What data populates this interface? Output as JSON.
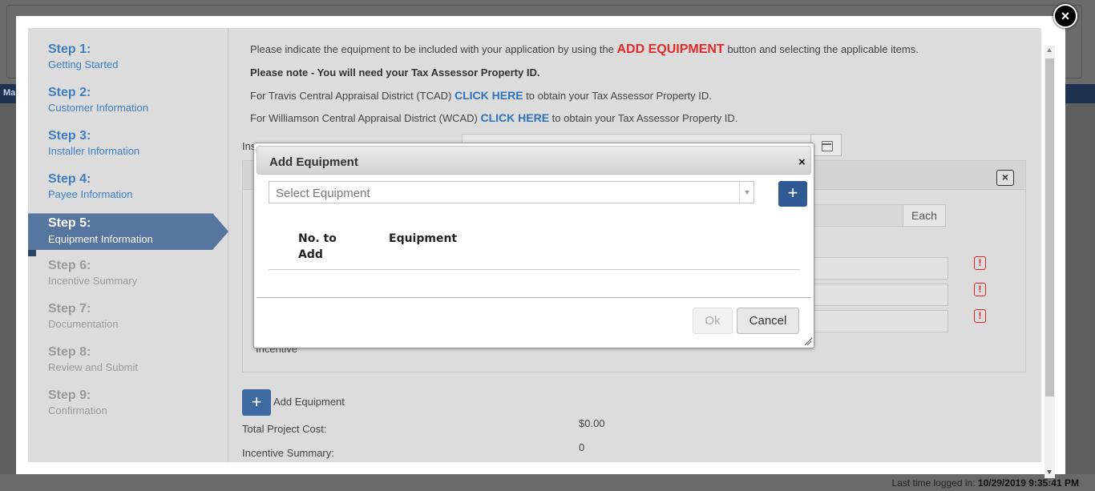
{
  "background": {
    "nav_text": "Ma",
    "last_login_label": "Last time logged in:",
    "last_login_value": "10/29/2019 9:35:41 PM"
  },
  "main_modal": {
    "close_icon": "×"
  },
  "steps": [
    {
      "num": "Step 1:",
      "label": "Getting Started"
    },
    {
      "num": "Step 2:",
      "label": "Customer Information"
    },
    {
      "num": "Step 3:",
      "label": "Installer Information"
    },
    {
      "num": "Step 4:",
      "label": "Payee Information"
    },
    {
      "num": "Step 5:",
      "label": "Equipment Information"
    },
    {
      "num": "Step 6:",
      "label": "Incentive Summary"
    },
    {
      "num": "Step 7:",
      "label": "Documentation"
    },
    {
      "num": "Step 8:",
      "label": "Review and Submit"
    },
    {
      "num": "Step 9:",
      "label": "Confirmation"
    }
  ],
  "content": {
    "intro_before": "Please indicate the equipment to be included with your application by using the ",
    "intro_highlight": "ADD EQUIPMENT",
    "intro_after": " button and selecting the applicable items.",
    "note": "Please note - You will need your Tax Assessor Property ID.",
    "tcad_before": "For Travis Central Appraisal District (TCAD) ",
    "tcad_link": "CLICK HERE",
    "tcad_after": " to obtain your Tax Assessor Property ID.",
    "wcad_before": "For Williamson Central Appraisal District (WCAD) ",
    "wcad_link": "CLICK HERE",
    "wcad_after": " to obtain your Tax Assessor Property ID.",
    "installation_label": "Ins",
    "each_label": "Each",
    "incentive_label": "Incentive",
    "add_equipment_label": "Add Equipment",
    "total_project_cost_label": "Total Project Cost:",
    "total_project_cost_value": "$0.00",
    "incentive_summary_label": "Incentive Summary:",
    "incentive_summary_value": "0"
  },
  "dialog": {
    "title": "Add Equipment",
    "close": "×",
    "select_placeholder": "Select Equipment",
    "add_button": "+",
    "col_no_to_add_line1": "No. to",
    "col_no_to_add_line2": "Add",
    "col_equipment": "Equipment",
    "ok_label": "Ok",
    "cancel_label": "Cancel"
  },
  "colors": {
    "accent_blue": "#3e6aa2",
    "link_blue": "#2f72b8",
    "highlight_red": "#e32b2b",
    "active_step": "#56769f"
  }
}
